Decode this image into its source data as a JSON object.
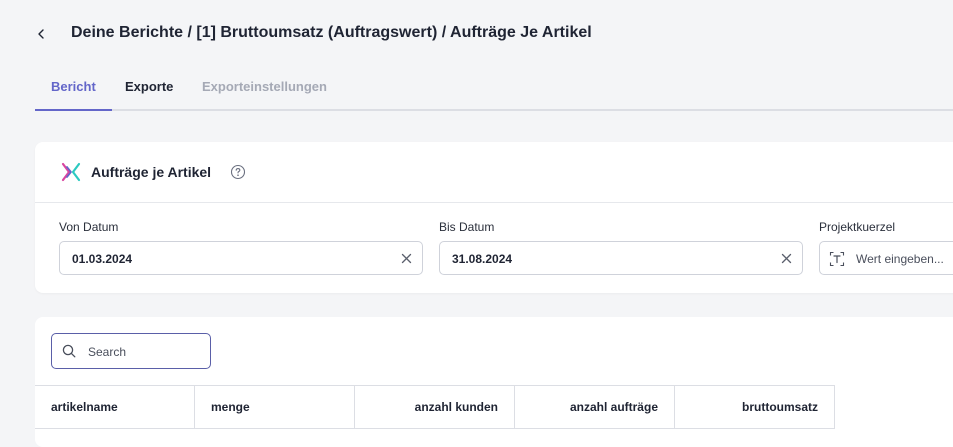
{
  "header": {
    "title": "Deine Berichte / [1] Bruttoumsatz (Auftragswert) / Aufträge Je Artikel"
  },
  "tabs": [
    {
      "label": "Bericht",
      "state": "active"
    },
    {
      "label": "Exporte",
      "state": "normal"
    },
    {
      "label": "Exporteinstellungen",
      "state": "disabled"
    }
  ],
  "filter_card": {
    "title": "Aufträge je Artikel",
    "fields": {
      "von": {
        "label": "Von Datum",
        "value": "01.03.2024"
      },
      "bis": {
        "label": "Bis Datum",
        "value": "31.08.2024"
      },
      "projekt": {
        "label": "Projektkuerzel",
        "placeholder": "Wert eingeben..."
      }
    }
  },
  "table": {
    "search_placeholder": "Search",
    "columns": [
      "artikelname",
      "menge",
      "anzahl kunden",
      "anzahl aufträge",
      "bruttoumsatz"
    ]
  },
  "colors": {
    "accent": "#6366c9",
    "background": "#f4f5f7",
    "card": "#ffffff"
  }
}
